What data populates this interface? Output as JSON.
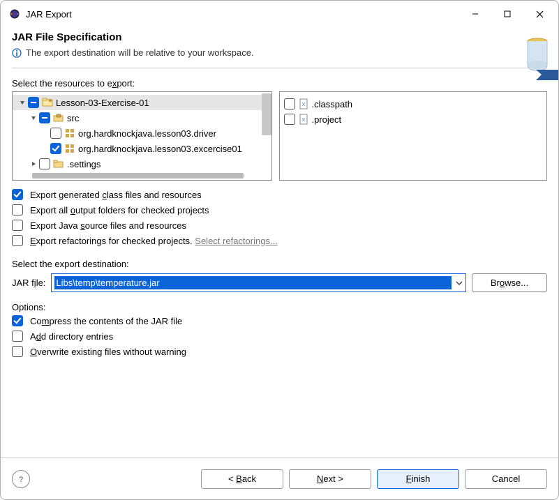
{
  "window": {
    "title": "JAR Export"
  },
  "banner": {
    "heading": "JAR File Specification",
    "info": "The export destination will be relative to your workspace."
  },
  "resources": {
    "label_pre": "Select the resources to e",
    "label_u": "x",
    "label_post": "port:",
    "tree": {
      "project": "Lesson-03-Exercise-01",
      "src": "src",
      "pkg_driver": "org.hardknockjava.lesson03.driver",
      "pkg_excercise": "org.hardknockjava.lesson03.excercise01",
      "settings": ".settings"
    },
    "files": {
      "classpath": ".classpath",
      "project": ".project"
    }
  },
  "export_opts": {
    "gen_pre": "Export generated ",
    "gen_u": "c",
    "gen_post": "lass files and resources",
    "all_pre": "Export all ",
    "all_u": "o",
    "all_post": "utput folders for checked projects",
    "src_pre": "Export Java ",
    "src_u": "s",
    "src_post": "ource files and resources",
    "ref_pre": "",
    "ref_u": "E",
    "ref_post": "xport refactorings for checked projects. ",
    "ref_link": "Select refactorings..."
  },
  "dest": {
    "label": "Select the export destination:",
    "pre": "JAR f",
    "u": "i",
    "post": "le:",
    "value": "Libs\\temp\\temperature.jar",
    "browse_pre": "Br",
    "browse_u": "o",
    "browse_post": "wse..."
  },
  "options": {
    "header": "Options:",
    "compress_pre": "Co",
    "compress_u": "m",
    "compress_post": "press the contents of the JAR file",
    "dir_pre": "A",
    "dir_u": "d",
    "dir_post": "d directory entries",
    "over_pre": "",
    "over_u": "O",
    "over_post": "verwrite existing files without warning"
  },
  "footer": {
    "back_pre": "< ",
    "back_u": "B",
    "back_post": "ack",
    "next_pre": "",
    "next_u": "N",
    "next_post": "ext >",
    "finish_pre": "",
    "finish_u": "F",
    "finish_post": "inish",
    "cancel": "Cancel"
  }
}
